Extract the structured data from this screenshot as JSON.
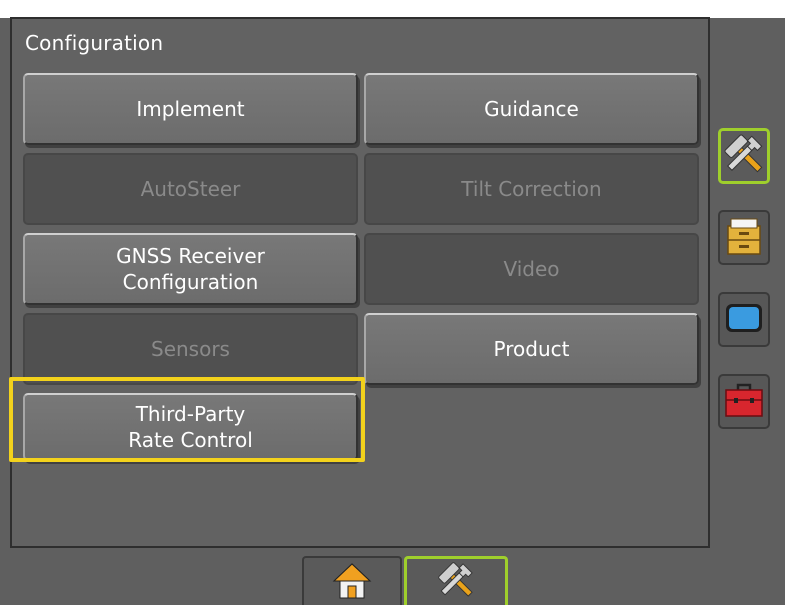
{
  "config": {
    "title": "Configuration",
    "buttons": {
      "implement": "Implement",
      "guidance": "Guidance",
      "autosteer": "AutoSteer",
      "tilt_correction": "Tilt Correction",
      "gnss_line1": "GNSS Receiver",
      "gnss_line2": "Configuration",
      "video": "Video",
      "sensors": "Sensors",
      "product": "Product",
      "third_party_line1": "Third-Party",
      "third_party_line2": "Rate Control"
    },
    "button_states": {
      "implement": "enabled",
      "guidance": "enabled",
      "autosteer": "disabled",
      "tilt_correction": "disabled",
      "gnss_receiver_configuration": "enabled",
      "video": "disabled",
      "sensors": "disabled",
      "product": "enabled",
      "third_party_rate_control": "enabled (highlighted)"
    }
  },
  "sidebar": {
    "tabs": [
      {
        "icon": "tools-icon",
        "active": true
      },
      {
        "icon": "file-cabinet-icon",
        "active": false
      },
      {
        "icon": "display-icon",
        "active": false
      },
      {
        "icon": "toolbox-icon",
        "active": false
      }
    ]
  },
  "bottom_nav": {
    "tabs": [
      {
        "icon": "home-icon",
        "active": false
      },
      {
        "icon": "tools-icon",
        "active": true
      }
    ]
  },
  "colors": {
    "active_outline": "#9fcf2c",
    "highlight": "#f3d21c",
    "panel_background": "#626262"
  }
}
